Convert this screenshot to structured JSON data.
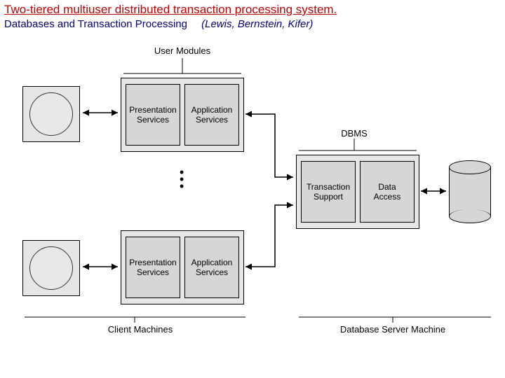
{
  "title": "Two-tiered multiuser distributed transaction processing system.",
  "subtitle": "Databases and Transaction Processing",
  "subtitle_authors": "(Lewis, Bernstein, Kifer)",
  "labels": {
    "user_modules": "User Modules",
    "dbms": "DBMS",
    "client_machines": "Client Machines",
    "db_server_machine": "Database Server Machine"
  },
  "boxes": {
    "presentation_services": "Presentation\nServices",
    "application_services": "Application\nServices",
    "transaction_support": "Transaction\nSupport",
    "data_access": "Data\nAccess"
  }
}
